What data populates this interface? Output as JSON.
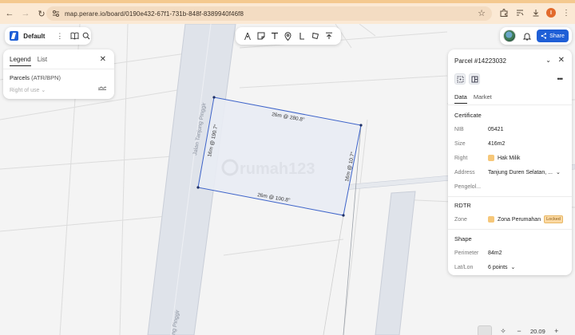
{
  "browser": {
    "url": "map.perare.io/board/0190e432-67f1-731b-848f-8389940f46f8",
    "profile_initial": "I"
  },
  "board": {
    "name": "Default"
  },
  "toolbar": {
    "tools": [
      {
        "name": "path-tool-icon",
        "glyph": "A"
      },
      {
        "name": "note-tool-icon",
        "glyph": "▭"
      },
      {
        "name": "text-tool-icon",
        "glyph": "T"
      },
      {
        "name": "pin-tool-icon",
        "glyph": "⌖"
      },
      {
        "name": "line-tool-icon",
        "glyph": "L"
      },
      {
        "name": "shape-tool-icon",
        "glyph": "◇"
      },
      {
        "name": "upload-tool-icon",
        "glyph": "⤒"
      }
    ]
  },
  "header": {
    "share_label": "Share"
  },
  "legend": {
    "tabs": [
      "Legend",
      "List"
    ],
    "layer_title": "Parcels",
    "layer_subtitle": "(ATR/BPN)",
    "select_placeholder": "Right of use"
  },
  "map": {
    "road_label": "Jalan Tanjung Pinggir",
    "road_label_bottom": "ng Pinggir",
    "watermark": "rumah123",
    "dimensions": {
      "top": "26m @ 280.8°",
      "left": "16m @ 190.7°",
      "right": "16m @ 10.7°",
      "bottom": "26m @ 100.8°"
    },
    "zoom": "20.09"
  },
  "parcel": {
    "title": "Parcel #14223032",
    "tabs": [
      "Data",
      "Market"
    ],
    "certificate_title": "Certificate",
    "nib_label": "NIB",
    "nib": "05421",
    "size_label": "Size",
    "size": "416m2",
    "right_label": "Right",
    "right": "Hak Milik",
    "address_label": "Address",
    "address": "Tanjung Duren Selatan, ...",
    "manager_label": "Pengelol...",
    "rdtr_title": "RDTR",
    "zone_label": "Zone",
    "zone": "Zona Perumahan",
    "zone_badge": "Locked",
    "shape_title": "Shape",
    "perimeter_label": "Perimeter",
    "perimeter": "84m2",
    "latlon_label": "Lat/Lon",
    "latlon": "6 points"
  },
  "colors": {
    "accent": "#1f5fd6",
    "parcel_stroke": "#3d63c9",
    "parcel_fill": "#e9ecf4",
    "zone_swatch": "#f6c779"
  }
}
